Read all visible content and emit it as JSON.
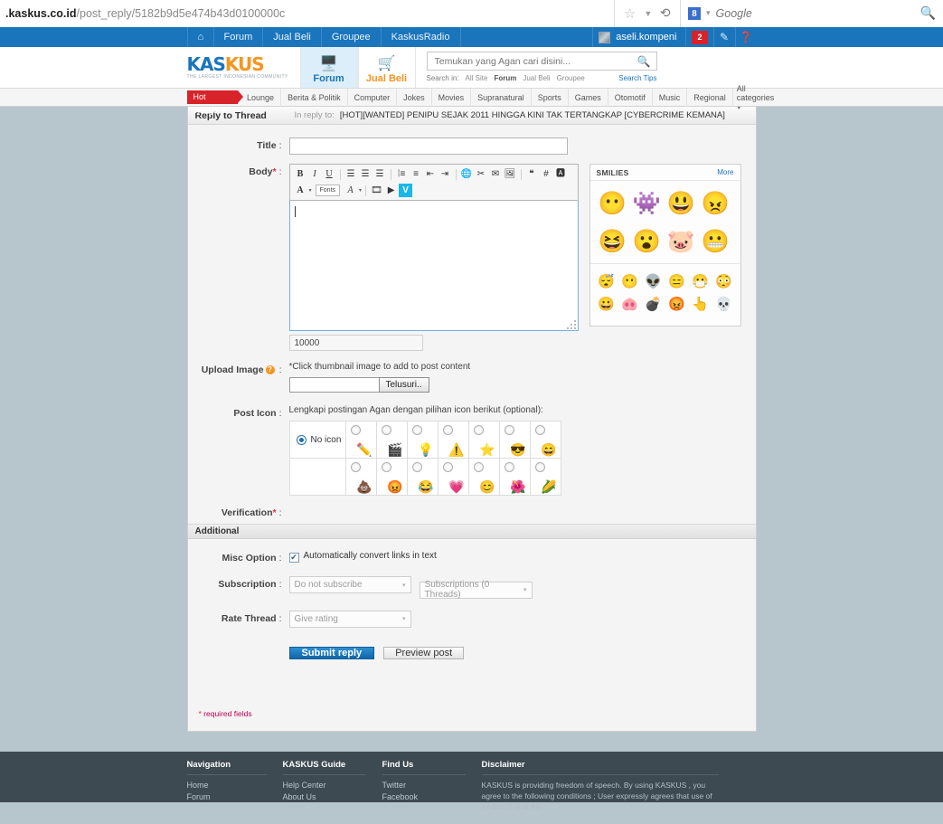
{
  "browser": {
    "url_host": ".kaskus.co.id",
    "url_path": "/post_reply/5182b9d5e474b43d0100000c",
    "star_icon": "star-icon",
    "reload_icon": "reload-icon",
    "search_engine": "Google",
    "search_engine_mark": "8",
    "search_icon": "search-icon"
  },
  "top_nav": {
    "home_icon": "home-icon",
    "items": [
      {
        "label": "Forum"
      },
      {
        "label": "Jual Beli"
      },
      {
        "label": "Groupee"
      },
      {
        "label": "KaskusRadio"
      }
    ],
    "username": "aseli.kompeni",
    "notification_count": "2",
    "compose_icon": "pencil-icon",
    "help_icon": "question-icon"
  },
  "header": {
    "logo_kas": "KAS",
    "logo_kus": "KUS",
    "logo_tagline": "THE LARGEST INDONESIAN COMMUNITY",
    "tabs": [
      {
        "label": "Forum",
        "icon": "forum-icon",
        "active": true
      },
      {
        "label": "Jual Beli",
        "icon": "cart-icon",
        "active": false
      }
    ],
    "search": {
      "placeholder": "Temukan yang Agan cari disini...",
      "search_in_label": "Search in:",
      "scopes": [
        "All Site",
        "Forum",
        "Jual Beli",
        "Groupee"
      ],
      "selected_scope": "Forum",
      "tips_label": "Search Tips"
    }
  },
  "category_nav": {
    "hot_label": "Hot categories",
    "items": [
      "Lounge",
      "Berita & Politik",
      "Computer",
      "Jokes",
      "Movies",
      "Supranatural",
      "Sports",
      "Games",
      "Otomotif",
      "Music",
      "Regional"
    ],
    "all_label": "All categories"
  },
  "panel": {
    "title": "Reply to Thread",
    "in_reply_label": "In reply to:",
    "thread_title": "[HOT][WANTED] PENIPU SEJAK 2011 HINGGA KINI TAK TERTANGKAP [CYBERCRIME KEMANA]"
  },
  "form": {
    "title": {
      "label": "Title",
      "value": "",
      "placeholder": ""
    },
    "body": {
      "label": "Body",
      "required_mark": "*",
      "value": "",
      "char_counter": "10000"
    },
    "toolbar": {
      "bold": "B",
      "italic": "I",
      "underline": "U",
      "align_left": "align-left-icon",
      "align_center": "align-center-icon",
      "align_right": "align-right-icon",
      "bullet_list": "bullet-list-icon",
      "numbered_list": "numbered-list-icon",
      "outdent": "outdent-icon",
      "indent": "indent-icon",
      "link": "link-icon",
      "unlink": "unlink-icon",
      "email": "email-icon",
      "image": "image-icon",
      "quote": "quote-icon",
      "code": "#",
      "spoiler": "spoiler-icon",
      "font_color": "A",
      "fonts_label": "Fonts",
      "font_size": "A",
      "video": "video-icon",
      "youtube": "youtube-icon",
      "vimeo": "V"
    },
    "smilies": {
      "title": "SMILIES",
      "more_label": "More",
      "big": [
        "😶",
        "👾",
        "😃",
        "😠",
        "😆",
        "😮",
        "🐷",
        "😬"
      ],
      "small": [
        "😴",
        "😶",
        "👽",
        "😑",
        "😷",
        "😳",
        "😀",
        "🐽",
        "💣",
        "😡",
        "👆",
        "💀"
      ]
    },
    "upload": {
      "label": "Upload Image",
      "help_icon": "question-icon",
      "hint": "*Click thumbnail image to add to post content",
      "file_value": "",
      "browse_label": "Telusuri.."
    },
    "post_icon": {
      "label": "Post Icon",
      "hint": "Lengkapi postingan Agan dengan pilihan icon berikut (optional):",
      "no_icon_label": "No icon",
      "no_icon_selected": true,
      "row1": [
        "✏️",
        "🎬",
        "💡",
        "⚠️",
        "⭐",
        "😎",
        "😄"
      ],
      "row2": [
        "💩",
        "😡",
        "😂",
        "💗",
        "😊",
        "🌺",
        "🌽"
      ]
    },
    "verification": {
      "label": "Verification",
      "required_mark": "*"
    },
    "additional_heading": "Additional",
    "misc_option": {
      "label": "Misc Option",
      "checkbox_label": "Automatically convert links in text",
      "checked": true
    },
    "subscription": {
      "label": "Subscription",
      "mode_value": "Do not subscribe",
      "list_value": "Subscriptions (0 Threads)"
    },
    "rate_thread": {
      "label": "Rate Thread",
      "value": "Give rating"
    },
    "submit_label": "Submit reply",
    "preview_label": "Preview post",
    "required_note_mark": "*",
    "required_note": " required fields"
  },
  "footer": {
    "columns": [
      {
        "heading": "Navigation",
        "links": [
          "Home",
          "Forum"
        ]
      },
      {
        "heading": "KASKUS Guide",
        "links": [
          "Help Center",
          "About Us"
        ]
      },
      {
        "heading": "Find Us",
        "links": [
          "Twitter",
          "Facebook"
        ]
      }
    ],
    "disclaimer_heading": "Disclaimer",
    "disclaimer_text": "KASKUS is providing freedom of speech. By using KASKUS , you agree to the following conditions ; User expressly agrees that use of KASKUS is at the"
  },
  "colors": {
    "brand_blue": "#1a75bc",
    "brand_orange": "#f7941e",
    "hot_red": "#d8232a",
    "page_bg": "#b7c5cd",
    "footer_bg": "#3e4a52"
  }
}
